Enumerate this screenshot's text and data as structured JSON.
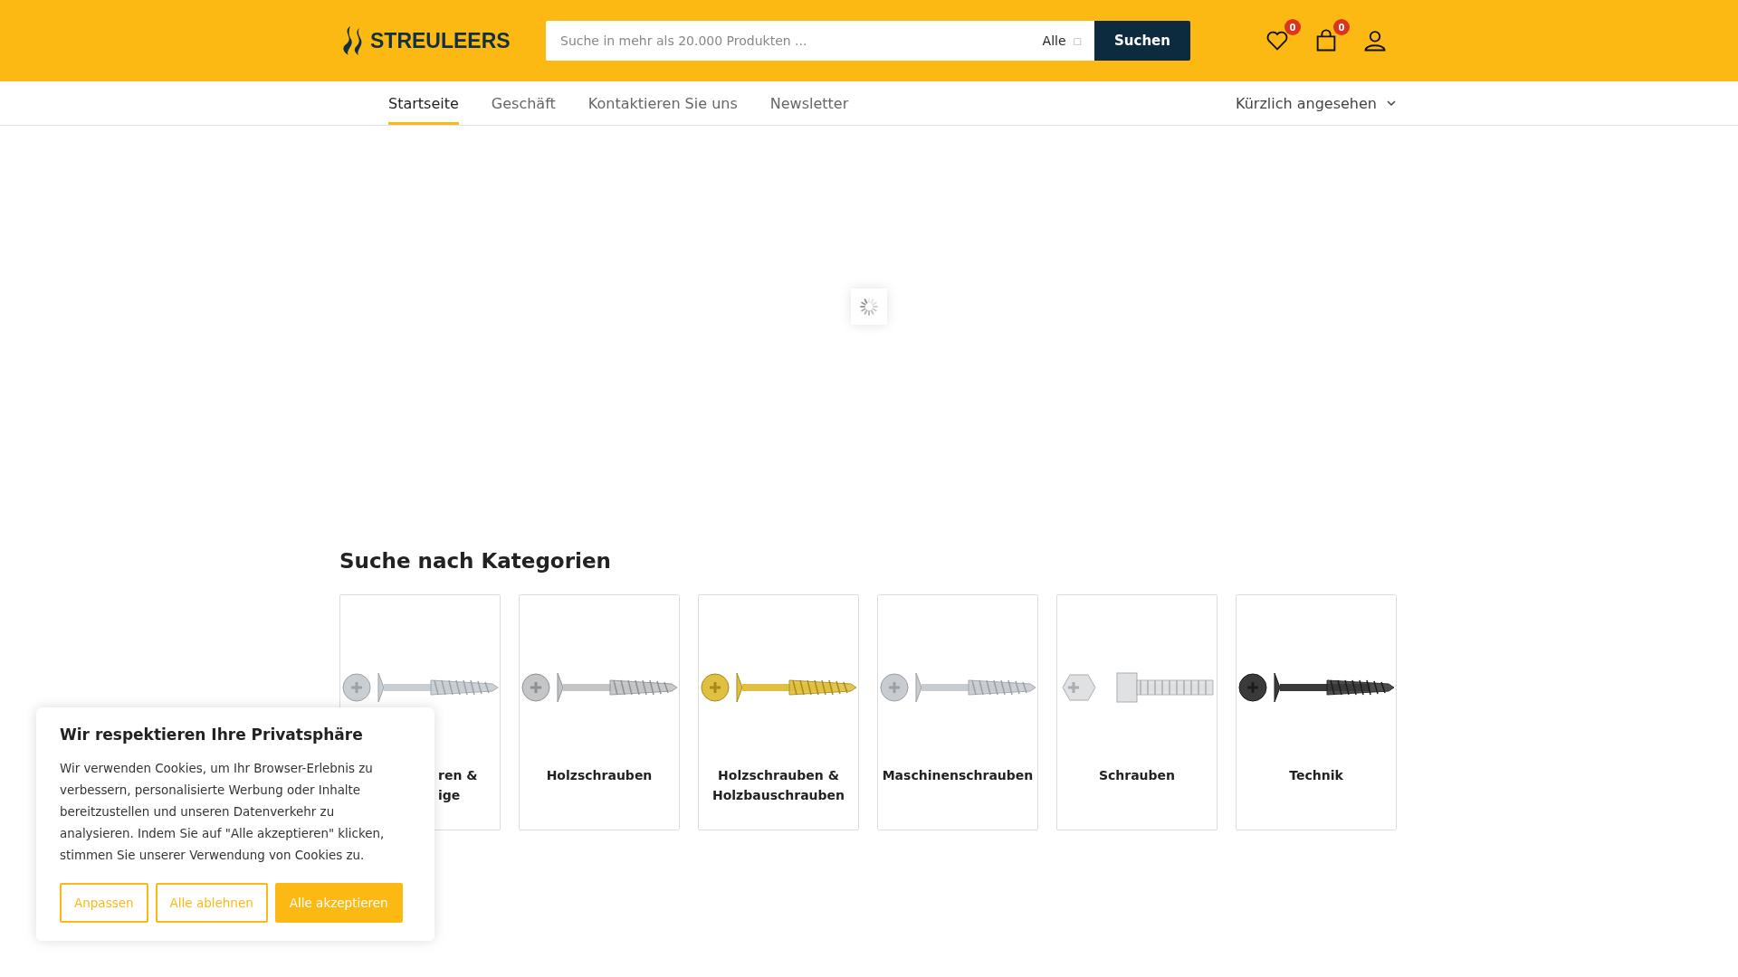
{
  "header": {
    "logo": "STREULEERS",
    "search": {
      "placeholder": "Suche in mehr als 20.000 Produkten ...",
      "category": "Alle",
      "category_icon": "□",
      "button": "Suchen"
    },
    "wishlist_count": "0",
    "cart_count": "0"
  },
  "nav": {
    "items": [
      {
        "label": "Startseite",
        "selected": true
      },
      {
        "label": "Geschäft",
        "selected": false
      },
      {
        "label": "Kontaktieren Sie uns",
        "selected": false
      },
      {
        "label": "Newsletter",
        "selected": false
      }
    ],
    "recent": "Kürzlich angesehen"
  },
  "categories": {
    "title": "Suche nach Kategorien",
    "items": [
      {
        "lines": [
          "ren &",
          "ige"
        ],
        "partial": true
      },
      {
        "lines": [
          "Holzschrauben"
        ],
        "partial": false
      },
      {
        "lines": [
          "Holzschrauben &",
          "Holzbauschrauben"
        ],
        "partial": false
      },
      {
        "lines": [
          "Maschinenschrauben"
        ],
        "partial": false
      },
      {
        "lines": [
          "Schrauben"
        ],
        "partial": false
      },
      {
        "lines": [
          "Technik"
        ],
        "partial": false
      }
    ]
  },
  "cookie": {
    "title": "Wir respektieren Ihre Privatsphäre",
    "text": "Wir verwenden Cookies, um Ihr Browser-Erlebnis zu verbessern, personalisierte Werbung oder Inhalte bereitzustellen und unseren Datenverkehr zu analysieren. Indem Sie auf \"Alle akzeptieren\" klicken, stimmen Sie unserer Verwendung von Cookies zu.",
    "buttons": [
      {
        "label": "Anpassen",
        "kind": "outline"
      },
      {
        "label": "Alle ablehnen",
        "kind": "outline"
      },
      {
        "label": "Alle akzeptieren",
        "kind": "filled"
      }
    ]
  }
}
